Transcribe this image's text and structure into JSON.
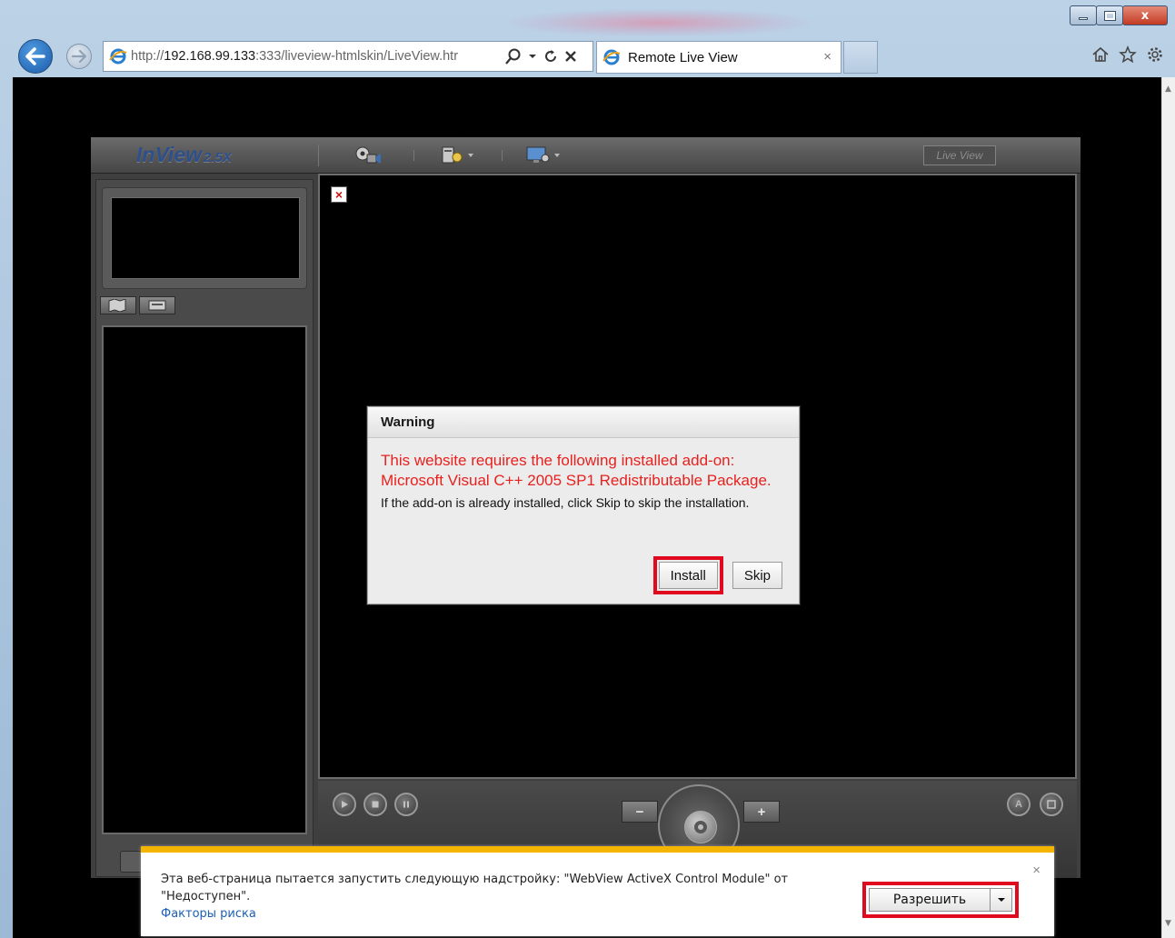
{
  "window": {
    "controls": {
      "close_glyph": "x"
    }
  },
  "address_bar": {
    "url_prefix": "http://",
    "url_host": "192.168.99.133",
    "url_rest": ":333/liveview-htmlskin/LiveView.htr"
  },
  "tab": {
    "title": "Remote Live View",
    "close_glyph": "×"
  },
  "app": {
    "brand_name": "InView",
    "brand_version": "2.5X",
    "live_view_label": "Live View",
    "error_badge": "×",
    "zoom_minus": "−",
    "zoom_plus": "+",
    "auto_label": "A"
  },
  "dialog": {
    "title": "Warning",
    "message_red": "This website requires the following installed add-on: Microsoft Visual C++ 2005 SP1 Redistributable Package.",
    "message_black": "If the add-on is already installed, click Skip to skip the installation.",
    "install_label": "Install",
    "skip_label": "Skip"
  },
  "notification": {
    "text": "Эта веб-страница пытается запустить следующую надстройку: \"WebView ActiveX Control Module\" от \"Недоступен\".",
    "link": "Факторы риска",
    "allow_label": "Разрешить",
    "close_glyph": "×"
  },
  "colors": {
    "highlight": "#e0091d",
    "warning_text": "#e8211e",
    "notification_stripe": "#f4b400",
    "link": "#1c5fb5"
  }
}
